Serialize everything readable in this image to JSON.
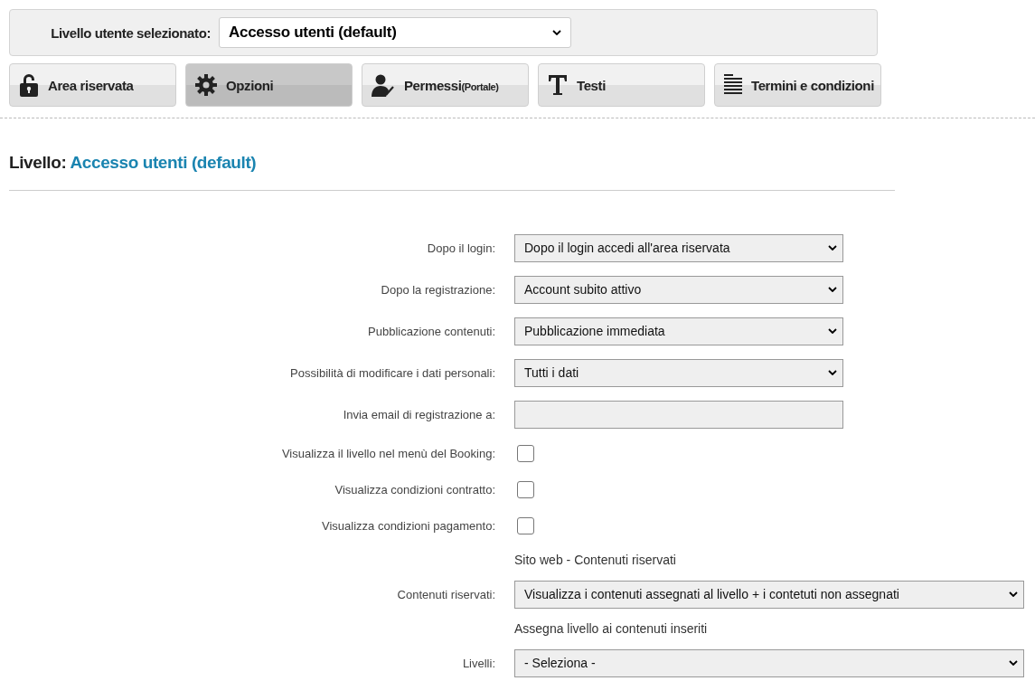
{
  "level_selector": {
    "label": "Livello utente selezionato:",
    "value": "Accesso utenti (default)"
  },
  "tabs": [
    {
      "label": "Area riservata",
      "selected": false
    },
    {
      "label": "Opzioni",
      "selected": true
    },
    {
      "label": "Permessi",
      "note": "(Portale)",
      "selected": false
    },
    {
      "label": "Testi",
      "selected": false
    },
    {
      "label": "Termini e condizioni",
      "selected": false
    }
  ],
  "heading": {
    "label": "Livello:",
    "value": "Accesso utenti (default)"
  },
  "form": [
    {
      "kind": "select",
      "label": "Dopo il login:",
      "value": "Dopo il login accedi all'area riservata"
    },
    {
      "kind": "select",
      "label": "Dopo la registrazione:",
      "value": "Account subito attivo"
    },
    {
      "kind": "select",
      "label": "Pubblicazione contenuti:",
      "value": "Pubblicazione immediata"
    },
    {
      "kind": "select",
      "label": "Possibilità di modificare i dati personali:",
      "value": "Tutti i dati"
    },
    {
      "kind": "text",
      "label": "Invia email di registrazione a:"
    },
    {
      "kind": "checkbox",
      "label": "Visualizza il livello nel menù del Booking:",
      "checked": false
    },
    {
      "kind": "checkbox",
      "label": "Visualizza condizioni contratto:",
      "checked": false
    },
    {
      "kind": "checkbox",
      "label": "Visualizza condizioni pagamento:",
      "checked": false
    },
    {
      "kind": "heading",
      "label": "Sito web - Contenuti riservati"
    },
    {
      "kind": "wide-select",
      "label": "Contenuti riservati:",
      "value": "Visualizza i contenuti assegnati al livello + i contetuti non assegnati"
    },
    {
      "kind": "heading",
      "label": "Assegna livello ai contenuti inseriti"
    },
    {
      "kind": "wide-select",
      "label": "Livelli:",
      "value": "- Seleziona -"
    }
  ]
}
